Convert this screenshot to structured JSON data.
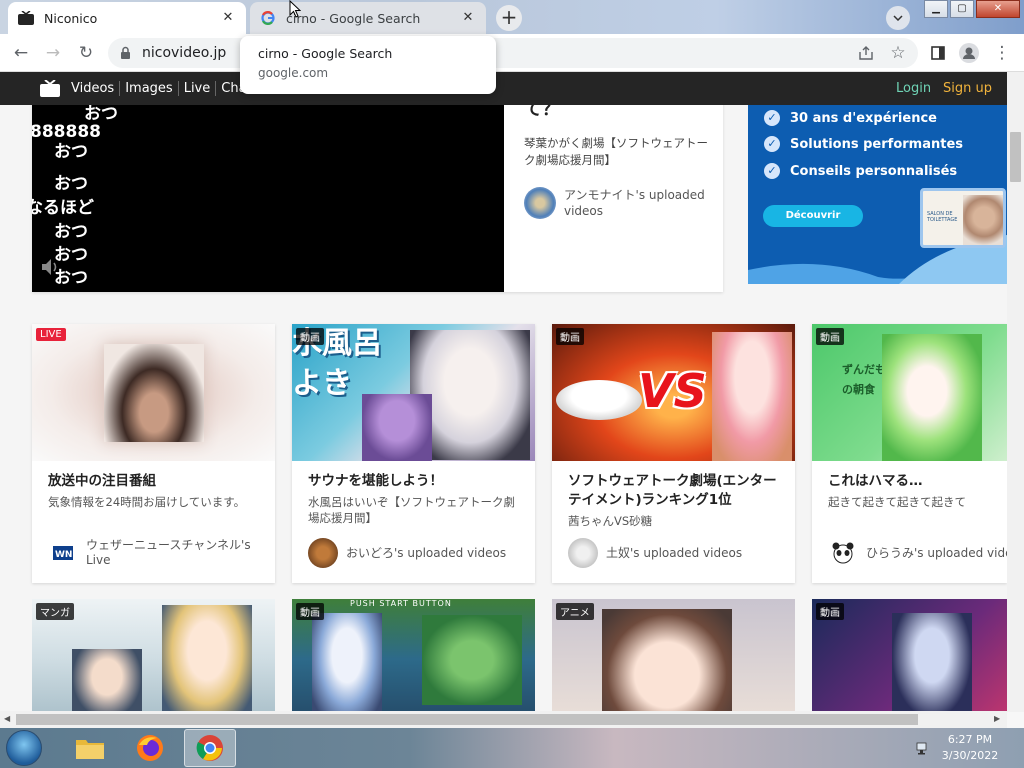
{
  "browser": {
    "tabs": [
      {
        "title": "Niconico",
        "active": true
      },
      {
        "title": "cirno - Google Search",
        "active": false
      }
    ],
    "url": "nicovideo.jp",
    "tooltip": {
      "title": "cirno - Google Search",
      "domain": "google.com"
    }
  },
  "site_nav": {
    "items": [
      "Videos",
      "Images",
      "Live",
      "Chan"
    ],
    "login": "Login",
    "signup": "Sign up"
  },
  "hero": {
    "comments": [
      "おつ",
      "888888",
      "おつ",
      "おつ",
      "なるほど",
      "おつ",
      "おつ",
      "おつ"
    ],
    "title": "て？",
    "description": "琴葉かがく劇場【ソフトウェアトーク劇場応援月間】",
    "uploader": "アンモナイト's uploaded videos"
  },
  "ad": {
    "items": [
      "30 ans d'expérience",
      "Solutions performantes",
      "Conseils personnalisés"
    ],
    "button": "Découvrir",
    "image_text": "SALON DE TOILETTAGE"
  },
  "cards": [
    {
      "badge": "LIVE",
      "title": "放送中の注目番組",
      "description": "気象情報を24時間お届けしています。",
      "uploader": "ウェザーニュースチャンネル's Live"
    },
    {
      "badge": "動画",
      "thumb_text": "水風呂よき",
      "title": "サウナを堪能しよう！",
      "description": "水風呂はいいぞ【ソフトウェアトーク劇場応援月間】",
      "uploader": "おいどろ's uploaded videos"
    },
    {
      "badge": "動画",
      "thumb_text": "VS",
      "title": "ソフトウェアトーク劇場(エンターテイメント)ランキング1位",
      "description": "茜ちゃんVS砂糖",
      "uploader": "土奴's uploaded videos"
    },
    {
      "badge": "動画",
      "thumb_text": "ずんだもんの朝食",
      "title": "これはハマる…",
      "description": "起きて起きて起きて起きて",
      "uploader": "ひらうみ's uploaded videos"
    }
  ],
  "cards_row2": [
    {
      "badge": "マンガ"
    },
    {
      "badge": "動画",
      "thumb_text": "PUSH START BUTTON"
    },
    {
      "badge": "アニメ"
    },
    {
      "badge": "動画"
    }
  ],
  "taskbar": {
    "time": "6:27 PM",
    "date": "3/30/2022"
  },
  "colors": {
    "live_badge": "#e8223a",
    "login": "#6fd3b5",
    "signup": "#f1b33c",
    "site_header": "#252525",
    "ad_bg": "#0d5db1"
  }
}
